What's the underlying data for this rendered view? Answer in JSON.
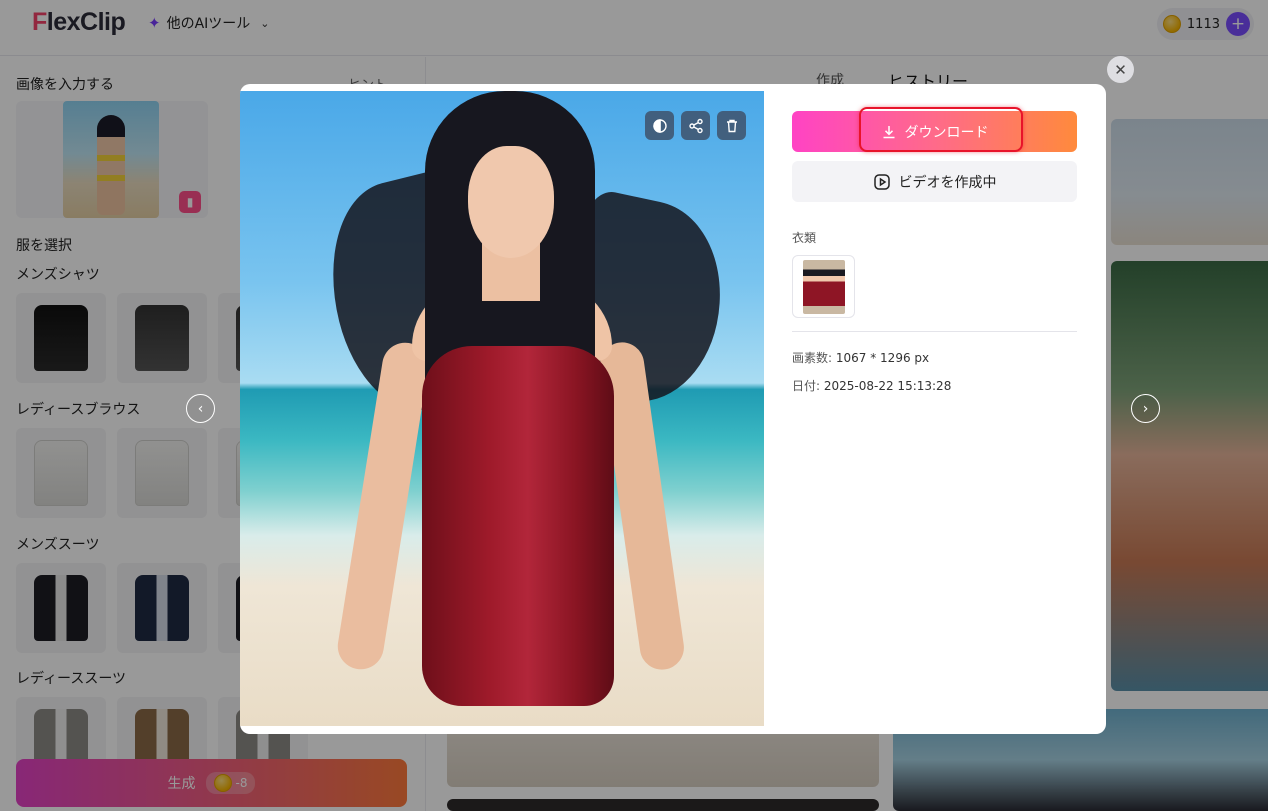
{
  "header": {
    "logo_f": "F",
    "logo_rest": "lexClip",
    "ai_tools_label": "他のAIツール",
    "credits": "1113",
    "plus_symbol": "+"
  },
  "left_panel": {
    "input_title": "画像を入力する",
    "hint_label": "ヒント",
    "select_title": "服を選択",
    "categories": [
      "メンズシャツ",
      "レディースブラウス",
      "メンズスーツ",
      "レディーススーツ"
    ],
    "generate_label": "生成",
    "generate_cost": "-8"
  },
  "history_tabs": {
    "create_tab": "作成",
    "history_tab": "ヒストリー"
  },
  "modal": {
    "download_label": "ダウンロード",
    "video_label": "ビデオを作成中",
    "clothing_label": "衣類",
    "pixels_key": "画素数:",
    "pixels_value": "1067 * 1296 px",
    "date_key": "日付:",
    "date_value": "2025-08-22 15:13:28"
  },
  "colors": {
    "accent_purple": "#7b4dff",
    "gradient_pink": "#ff43c4",
    "gradient_orange": "#ff8a3c",
    "highlight_red": "#e8132a"
  }
}
